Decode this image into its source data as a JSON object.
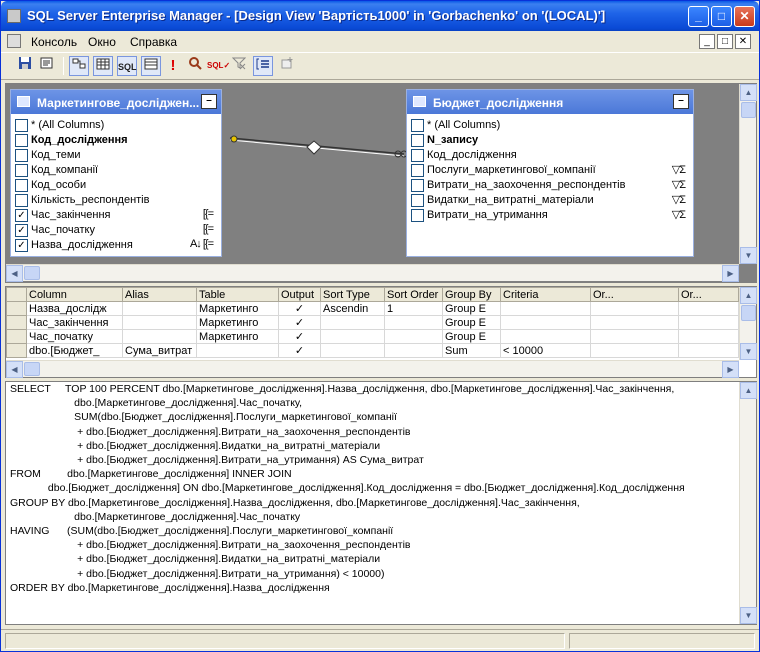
{
  "window": {
    "title": "SQL Server Enterprise Manager - [Design View 'Вартість1000' in 'Gorbachenko' on '(LOCAL)']",
    "minimize": "_",
    "maximize": "□",
    "close": "✕"
  },
  "menubar": {
    "items": [
      "Консоль",
      "Окно",
      "Справка"
    ]
  },
  "toolbar": {
    "tools": [
      "save-icon",
      "properties-icon",
      "diagram-pane-icon",
      "grid-pane-icon",
      "sql-pane-icon",
      "results-pane-icon",
      "run-icon",
      "verify-sql-icon",
      "check-sql-icon",
      "remove-filter-icon",
      "group-by-icon",
      "add-table-icon"
    ],
    "sql_label": "SQL"
  },
  "diagram": {
    "left_table": {
      "title": "Маркетингове_досліджен...",
      "minimize": "–",
      "columns": [
        {
          "name": "* (All Columns)",
          "checked": false,
          "bold": false,
          "tag": ""
        },
        {
          "name": "Код_дослідження",
          "checked": false,
          "bold": true,
          "tag": ""
        },
        {
          "name": "Код_теми",
          "checked": false,
          "bold": false,
          "tag": ""
        },
        {
          "name": "Код_компанії",
          "checked": false,
          "bold": false,
          "tag": ""
        },
        {
          "name": "Код_особи",
          "checked": false,
          "bold": false,
          "tag": ""
        },
        {
          "name": "Кількість_респондентів",
          "checked": false,
          "bold": false,
          "tag": ""
        },
        {
          "name": "Час_закінчення",
          "checked": true,
          "bold": false,
          "tag": "[{="
        },
        {
          "name": "Час_початку",
          "checked": true,
          "bold": false,
          "tag": "[{="
        },
        {
          "name": "Назва_дослідження",
          "checked": true,
          "bold": false,
          "tag": "A↓  [{="
        }
      ]
    },
    "right_table": {
      "title": "Бюджет_дослідження",
      "minimize": "–",
      "columns": [
        {
          "name": "* (All Columns)",
          "checked": false,
          "bold": false,
          "tag": ""
        },
        {
          "name": "N_запису",
          "checked": false,
          "bold": true,
          "tag": ""
        },
        {
          "name": "Код_дослідження",
          "checked": false,
          "bold": false,
          "tag": ""
        },
        {
          "name": "Послуги_маркетингової_компанії",
          "checked": false,
          "bold": false,
          "tag": "▽Σ"
        },
        {
          "name": "Витрати_на_заохочення_респондентів",
          "checked": false,
          "bold": false,
          "tag": "▽Σ"
        },
        {
          "name": "Видатки_на_витратні_матеріали",
          "checked": false,
          "bold": false,
          "tag": "▽Σ"
        },
        {
          "name": "Витрати_на_утримання",
          "checked": false,
          "bold": false,
          "tag": "▽Σ"
        }
      ]
    }
  },
  "grid": {
    "headers": [
      "",
      "Column",
      "Alias",
      "Table",
      "Output",
      "Sort Type",
      "Sort Order",
      "Group By",
      "Criteria",
      "Or...",
      "Or..."
    ],
    "rows": [
      [
        "",
        "Назва_дослідж",
        "",
        "Маркетинго",
        "✓",
        "Ascendin",
        "1",
        "Group E",
        "",
        "",
        ""
      ],
      [
        "",
        "Час_закінчення",
        "",
        "Маркетинго",
        "✓",
        "",
        "",
        "Group E",
        "",
        "",
        ""
      ],
      [
        "",
        "Час_початку",
        "",
        "Маркетинго",
        "✓",
        "",
        "",
        "Group E",
        "",
        "",
        ""
      ],
      [
        "",
        "dbo.[Бюджет_",
        "Сума_витрат",
        "",
        "✓",
        "",
        "",
        "Sum",
        "< 10000",
        "",
        ""
      ]
    ]
  },
  "sql": {
    "lines": [
      "SELECT     TOP 100 PERCENT dbo.[Маркетингове_дослідження].Назва_дослідження, dbo.[Маркетингове_дослідження].Час_закінчення,",
      "                      dbo.[Маркетингове_дослідження].Час_початку,",
      "                      SUM(dbo.[Бюджет_дослідження].Послуги_маркетингової_компанії",
      "                       + dbo.[Бюджет_дослідження].Витрати_на_заохочення_респондентів",
      "                       + dbo.[Бюджет_дослідження].Видатки_на_витратні_матеріали",
      "                       + dbo.[Бюджет_дослідження].Витрати_на_утримання) AS Сума_витрат",
      "FROM         dbo.[Маркетингове_дослідження] INNER JOIN",
      "             dbo.[Бюджет_дослідження] ON dbo.[Маркетингове_дослідження].Код_дослідження = dbo.[Бюджет_дослідження].Код_дослідження",
      "GROUP BY dbo.[Маркетингове_дослідження].Назва_дослідження, dbo.[Маркетингове_дослідження].Час_закінчення,",
      "                      dbo.[Маркетингове_дослідження].Час_початку",
      "HAVING      (SUM(dbo.[Бюджет_дослідження].Послуги_маркетингової_компанії",
      "                       + dbo.[Бюджет_дослідження].Витрати_на_заохочення_респондентів",
      "                       + dbo.[Бюджет_дослідження].Видатки_на_витратні_матеріали",
      "                       + dbo.[Бюджет_дослідження].Витрати_на_утримання) < 10000)",
      "ORDER BY dbo.[Маркетингове_дослідження].Назва_дослідження"
    ]
  },
  "colors": {
    "titlebar": "#0a58e6",
    "table_header": "#5a85de",
    "window_bg": "#ece9d8"
  }
}
